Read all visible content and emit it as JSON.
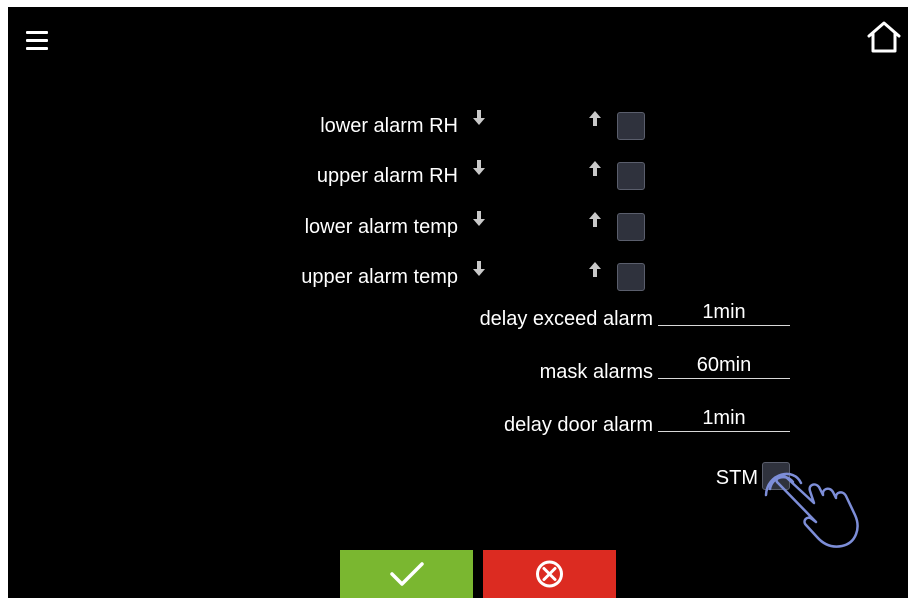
{
  "header": {
    "menu_icon": "hamburger-menu-icon",
    "home_icon": "home-icon"
  },
  "alarms": [
    {
      "label": "lower alarm RH"
    },
    {
      "label": "upper alarm RH"
    },
    {
      "label": "lower alarm temp"
    },
    {
      "label": "upper alarm temp"
    }
  ],
  "settings": [
    {
      "label": "delay exceed alarm",
      "value": "1min"
    },
    {
      "label": "mask alarms",
      "value": "60min"
    },
    {
      "label": "delay door alarm",
      "value": "1min"
    }
  ],
  "stm": {
    "label": "STM"
  },
  "footer": {
    "confirm_icon": "checkmark-icon",
    "cancel_icon": "cancel-x-circle-icon"
  },
  "colors": {
    "background": "#000000",
    "confirm": "#7ab730",
    "cancel": "#dc2b21",
    "checkbox": "#2f323d",
    "touch_hint": "#7d8ed8"
  }
}
